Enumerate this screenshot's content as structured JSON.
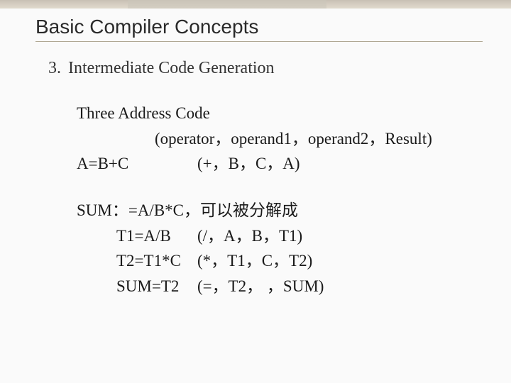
{
  "title": "Basic Compiler Concepts",
  "item_number": "3.",
  "item_label": "Intermediate Code Generation",
  "block1": {
    "heading": "Three Address Code",
    "format": "(operator，operand1，operand2，Result)",
    "example_left": "A=B+C",
    "example_right": "(+，B，C，A)"
  },
  "block2": {
    "heading": "SUM：=A/B*C，可以被分解成",
    "rows": [
      {
        "l": "T1=A/B",
        "r": "(/，A，B，T1)"
      },
      {
        "l": "T2=T1*C",
        "r": "(*，T1，C，T2)"
      },
      {
        "l": "SUM=T2",
        "r": "(=，T2，  ，SUM)"
      }
    ]
  }
}
